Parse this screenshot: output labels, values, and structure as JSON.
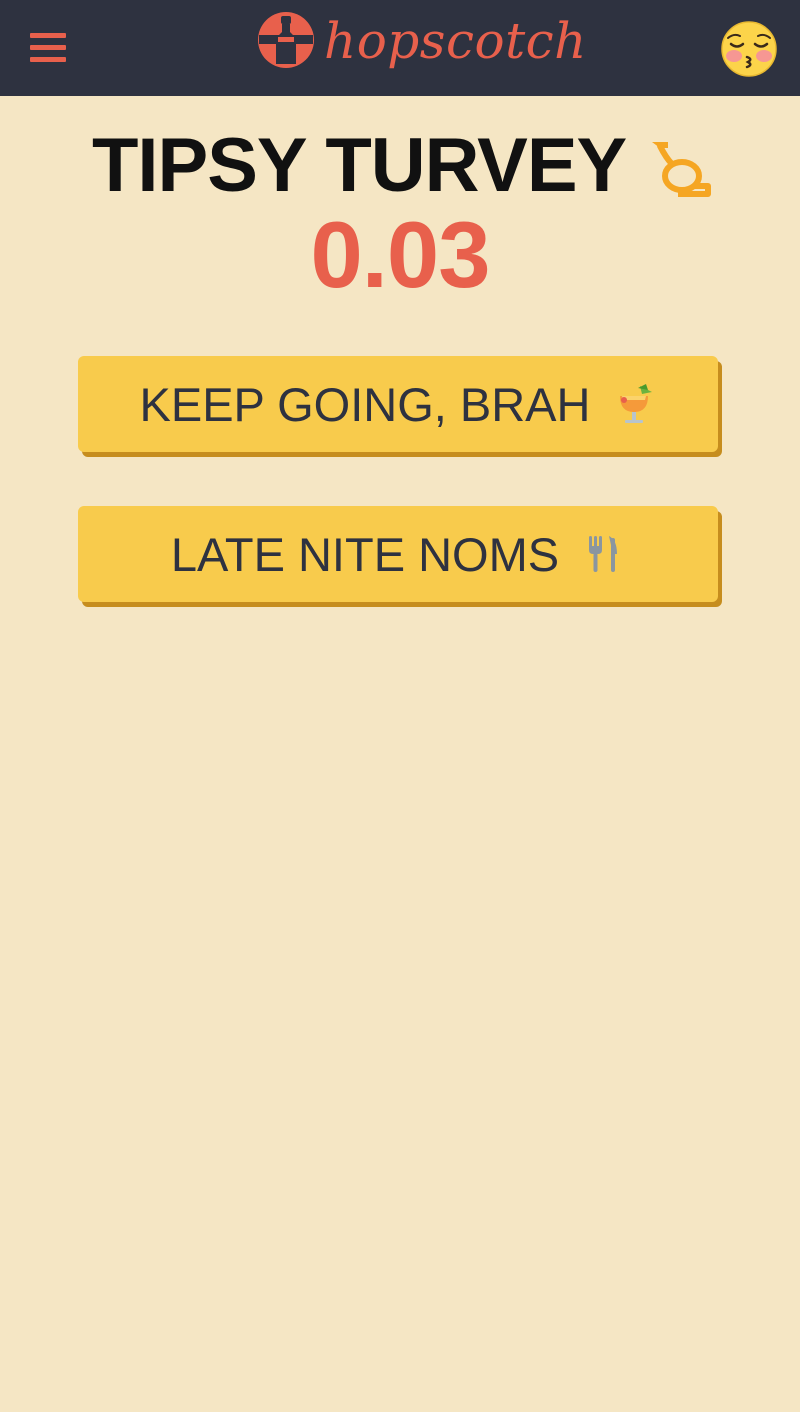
{
  "header": {
    "menu_icon": "hamburger-menu-icon",
    "logo_text": "hopscotch",
    "logo_icon": "bottle-badge-icon",
    "avatar_icon": "kissing-face-emoji-icon"
  },
  "status": {
    "name": "TIPSY TURVEY",
    "icon": "horn-icon",
    "bac_value": "0.03"
  },
  "actions": [
    {
      "label": "KEEP GOING, BRAH",
      "icon": "tropical-drink-icon"
    },
    {
      "label": "LATE NITE NOMS",
      "icon": "fork-knife-icon"
    }
  ],
  "colors": {
    "header_bg": "#2e3240",
    "page_bg": "#f5e6c4",
    "accent": "#e8604c",
    "button_bg": "#f8cb4c",
    "button_shadow": "#c68d1e",
    "icon_orange": "#f5a623"
  }
}
